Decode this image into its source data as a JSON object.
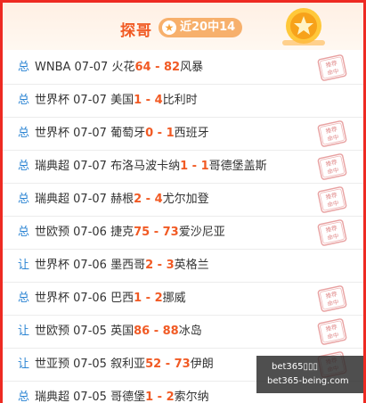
{
  "header": {
    "title": "探哥",
    "badge": "近20中14",
    "badge_icon": "star-icon",
    "medal_icon": "star-medal-icon"
  },
  "stamp_text": "推荐命中",
  "rows": [
    {
      "kind": "总",
      "league": "WNBA",
      "date": "07-07",
      "home": "火花",
      "home_score": "64",
      "away_score": "82",
      "away": "风暴",
      "hit": true
    },
    {
      "kind": "总",
      "league": "世界杯",
      "date": "07-07",
      "home": "美国",
      "home_score": "1",
      "away_score": "4",
      "away": "比利时",
      "hit": false
    },
    {
      "kind": "总",
      "league": "世界杯",
      "date": "07-07",
      "home": "葡萄牙",
      "home_score": "0",
      "away_score": "1",
      "away": "西班牙",
      "hit": true
    },
    {
      "kind": "总",
      "league": "瑞典超",
      "date": "07-07",
      "home": "布洛马波卡纳",
      "home_score": "1",
      "away_score": "1",
      "away": "哥德堡盖斯",
      "hit": true
    },
    {
      "kind": "总",
      "league": "瑞典超",
      "date": "07-07",
      "home": "赫根",
      "home_score": "2",
      "away_score": "4",
      "away": "尤尔加登",
      "hit": true
    },
    {
      "kind": "总",
      "league": "世欧预",
      "date": "07-06",
      "home": "捷克",
      "home_score": "75",
      "away_score": "73",
      "away": "爱沙尼亚",
      "hit": true
    },
    {
      "kind": "让",
      "league": "世界杯",
      "date": "07-06",
      "home": "墨西哥",
      "home_score": "2",
      "away_score": "3",
      "away": "英格兰",
      "hit": false
    },
    {
      "kind": "总",
      "league": "世界杯",
      "date": "07-06",
      "home": "巴西",
      "home_score": "1",
      "away_score": "2",
      "away": "挪威",
      "hit": true
    },
    {
      "kind": "让",
      "league": "世欧预",
      "date": "07-05",
      "home": "英国",
      "home_score": "86",
      "away_score": "88",
      "away": "冰岛",
      "hit": true
    },
    {
      "kind": "让",
      "league": "世亚预",
      "date": "07-05",
      "home": "叙利亚",
      "home_score": "52",
      "away_score": "73",
      "away": "伊朗",
      "hit": true
    },
    {
      "kind": "总",
      "league": "瑞典超",
      "date": "07-05",
      "home": "哥德堡",
      "home_score": "1",
      "away_score": "2",
      "away": "索尔纳",
      "hit": false
    }
  ],
  "watermark": {
    "line1": "bet365▯▯▯",
    "line2": "bet365-being.com"
  },
  "colors": {
    "border": "#ee2a22",
    "accent": "#f15a24",
    "kind": "#2b84d3",
    "stamp": "#e8a0a0"
  }
}
